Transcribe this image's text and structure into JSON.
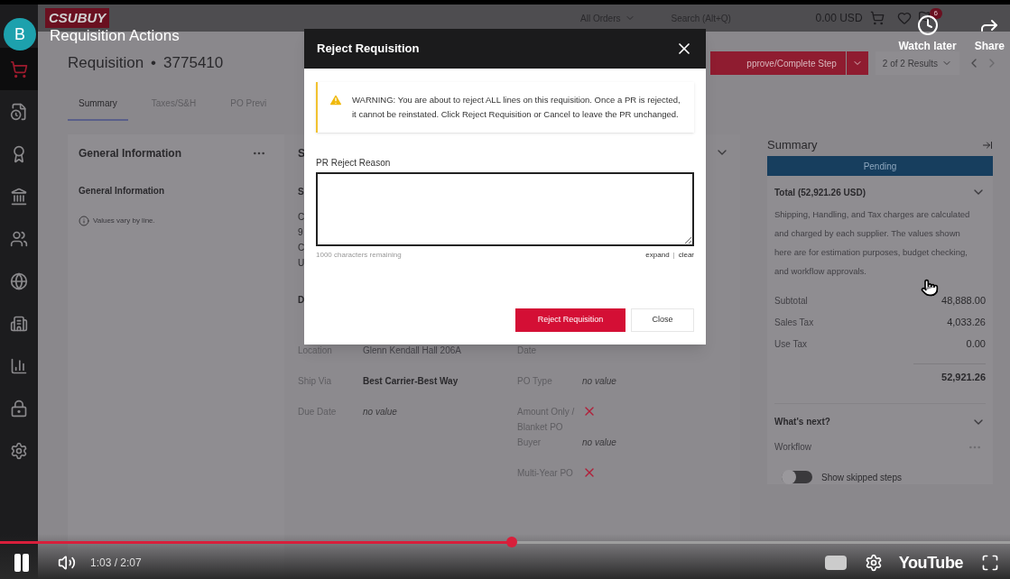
{
  "video": {
    "channel_initial": "B",
    "title": "Requisition Actions",
    "actions": [
      {
        "kind": "clock",
        "label": "Watch later"
      },
      {
        "kind": "share",
        "label": "Share"
      }
    ],
    "progress": {
      "level": 0.507
    },
    "time": "1:03 / 2:07",
    "logo": "YouTube"
  },
  "app": {
    "logo": "CSUBUY",
    "topbar": {
      "scope": "All Orders",
      "search_placeholder": "Search (Alt+Q)",
      "cart_total": "0.00 USD",
      "flag_badge": "6"
    },
    "header": {
      "title": "Requisition",
      "separator": "•",
      "number": "3775410",
      "primary_button": "pprove/Complete Step",
      "results": "2 of 2 Results"
    },
    "sidebar": [
      {
        "kind": "cart",
        "selected": true
      },
      {
        "kind": "file",
        "selected": false
      },
      {
        "kind": "award",
        "selected": false
      },
      {
        "kind": "bank",
        "selected": false
      },
      {
        "kind": "users",
        "selected": false
      },
      {
        "kind": "globe",
        "selected": false
      },
      {
        "kind": "building",
        "selected": false
      },
      {
        "kind": "chart",
        "selected": false
      },
      {
        "kind": "lock",
        "selected": false
      },
      {
        "kind": "gear",
        "selected": false
      }
    ],
    "tabs": [
      {
        "label": "Summary",
        "selected": true
      },
      {
        "label": "Taxes/S&H",
        "selected": false
      },
      {
        "label": "PO Previ",
        "selected": false
      }
    ],
    "general_card": {
      "title": "General Information",
      "subtitle": "General Information",
      "note": "Values vary by line."
    },
    "middle_card": {
      "title": "S",
      "subtitle": "S",
      "address_lines": [
        "C",
        "9",
        "C",
        "U"
      ],
      "section": "D",
      "left_rows": [
        {
          "label": "Location",
          "value": "Glenn Kendall Hall 206A",
          "kind": "faint"
        },
        {
          "label": "Ship Via",
          "value": "Best Carrier-Best Way",
          "kind": "bold"
        },
        {
          "label": "Due Date",
          "value": "no value",
          "kind": "empty"
        }
      ],
      "right_rows": [
        {
          "label": "Date",
          "kind": "blank"
        },
        {
          "label": "PO Type",
          "value": "no value",
          "kind": "empty"
        },
        {
          "label": "Amount Only / Blanket PO",
          "kind": "cross"
        },
        {
          "label": "Buyer",
          "value": "no value",
          "kind": "empty"
        },
        {
          "label": "Multi-Year PO",
          "kind": "cross"
        }
      ]
    },
    "summary": {
      "title": "Summary",
      "status": "Pending",
      "total_label": "Total (52,921.26 USD)",
      "note": "Shipping, Handling, and Tax charges are calculated and charged by each supplier. The values shown here are for estimation purposes, budget checking, and workflow approvals.",
      "lines": [
        {
          "label": "Subtotal",
          "value": "48,888.00"
        },
        {
          "label": "Sales Tax",
          "value": "4,033.26"
        },
        {
          "label": "Use Tax",
          "value": "0.00"
        }
      ],
      "grand_total": "52,921.26",
      "next_title": "What's next?",
      "workflow": "Workflow",
      "skipped_toggle": {
        "label": "Show skipped steps",
        "on": false
      }
    }
  },
  "dialog": {
    "title": "Reject Requisition",
    "warning": "WARNING: You are about to reject ALL lines on this requisition. Once a PR is rejected, it cannot be reinstated. Click Reject Requisition or Cancel to leave the PR unchanged.",
    "field_label": "PR Reject Reason",
    "remaining": "1000 characters remaining",
    "expand": "expand",
    "separator": "|",
    "clear": "clear",
    "buttons": [
      {
        "label": "Reject Requisition",
        "kind": "primary"
      },
      {
        "label": "Close",
        "kind": "secondary"
      }
    ]
  }
}
